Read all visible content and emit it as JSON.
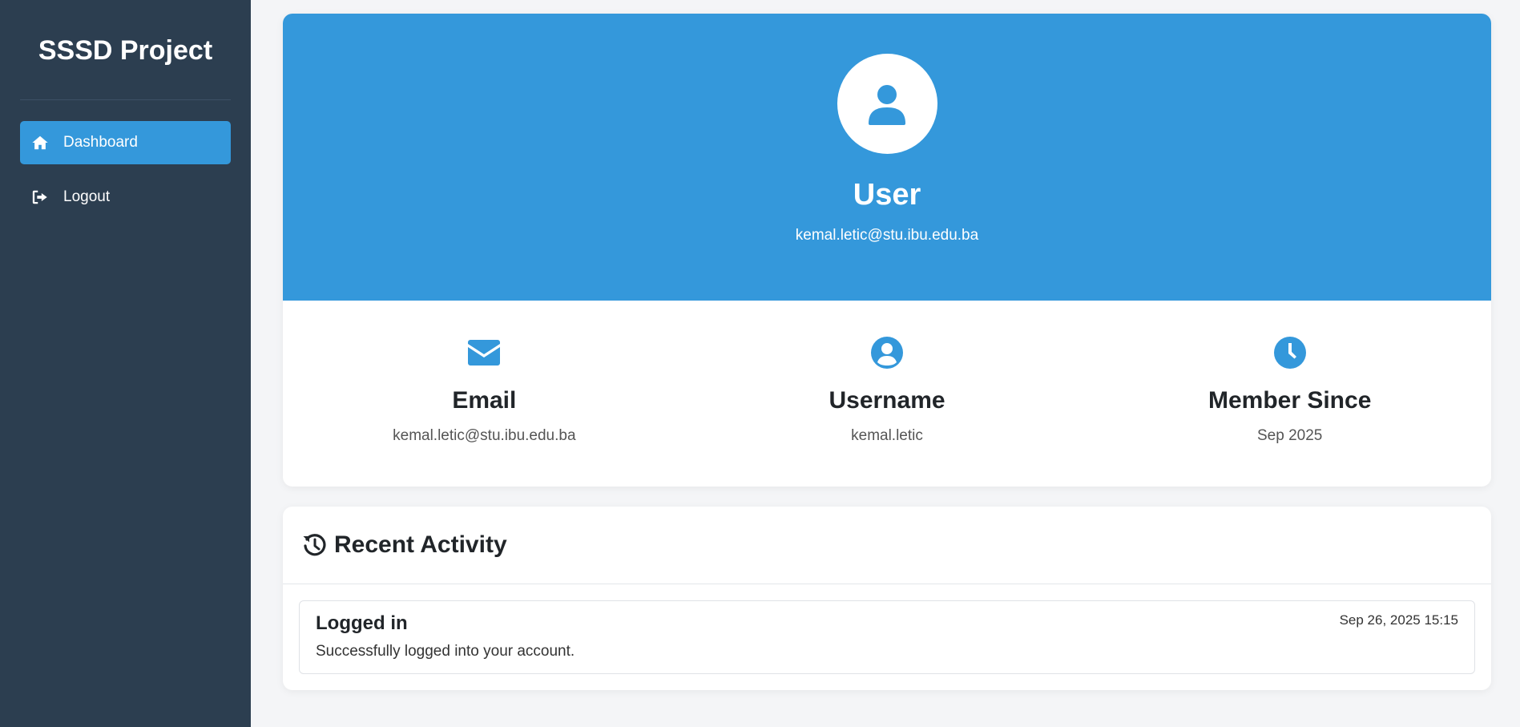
{
  "sidebar": {
    "brand": "SSSD Project",
    "items": [
      {
        "label": "Dashboard",
        "icon": "home-icon",
        "active": true
      },
      {
        "label": "Logout",
        "icon": "logout-icon",
        "active": false
      }
    ]
  },
  "profile": {
    "avatar_icon": "user-icon",
    "name": "User",
    "email": "kemal.letic@stu.ibu.edu.ba"
  },
  "stats": [
    {
      "icon": "envelope-icon",
      "title": "Email",
      "value": "kemal.letic@stu.ibu.edu.ba"
    },
    {
      "icon": "user-circle-icon",
      "title": "Username",
      "value": "kemal.letic"
    },
    {
      "icon": "clock-icon",
      "title": "Member Since",
      "value": "Sep 2025"
    }
  ],
  "activity": {
    "title": "Recent Activity",
    "icon": "history-icon",
    "items": [
      {
        "title": "Logged in",
        "description": "Successfully logged into your account.",
        "time": "Sep 26, 2025 15:15"
      }
    ]
  },
  "colors": {
    "sidebar_bg": "#2c3e50",
    "accent": "#3498db",
    "page_bg": "#f4f5f7"
  }
}
